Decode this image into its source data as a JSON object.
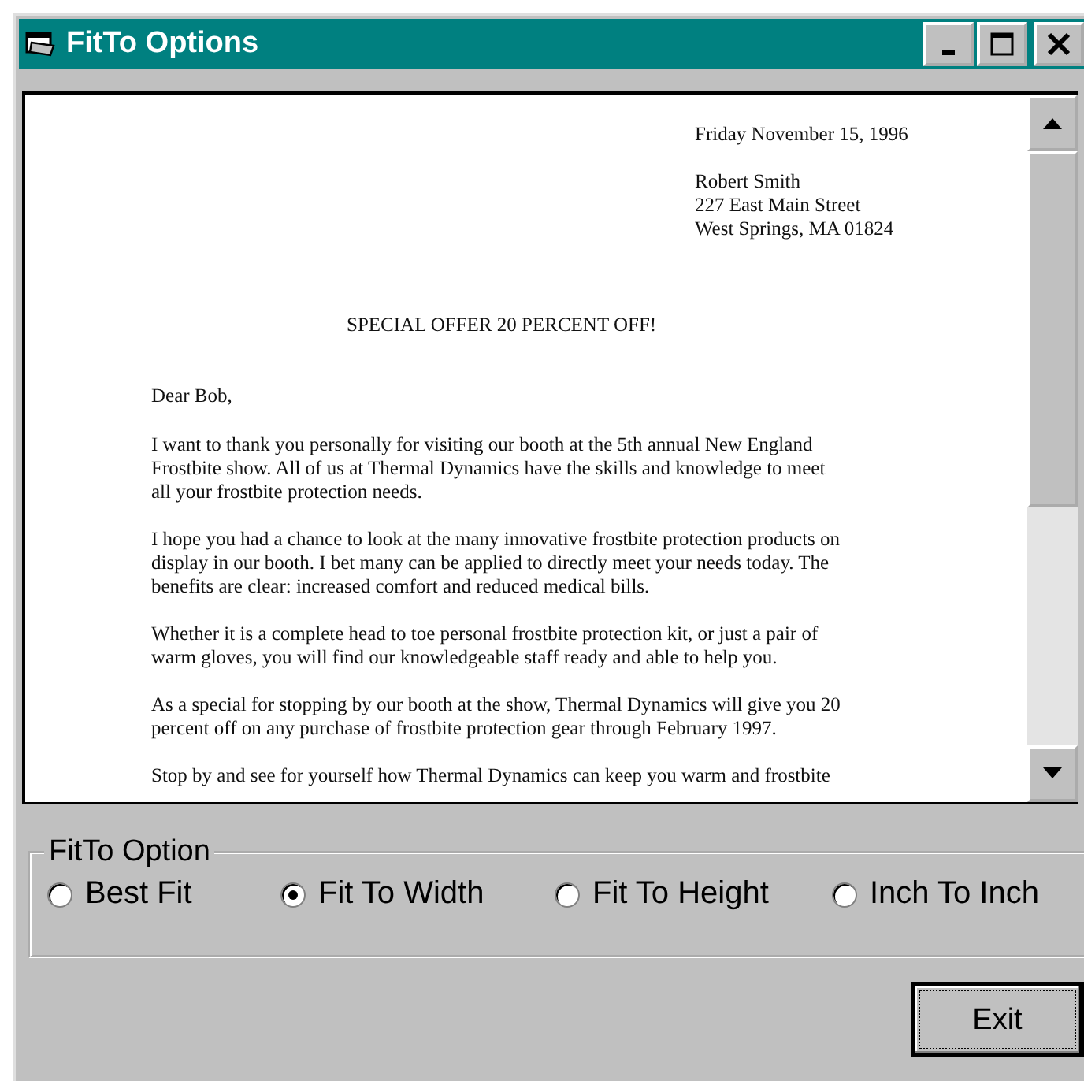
{
  "window": {
    "title": "FitTo Options"
  },
  "document": {
    "date": "Friday November 15, 1996",
    "address": [
      "Robert Smith",
      "227 East Main Street",
      "West Springs, MA 01824"
    ],
    "heading": "SPECIAL OFFER 20 PERCENT OFF!",
    "salutation": "Dear Bob,",
    "paragraphs": [
      "I want to thank you personally for visiting our booth at the 5th annual New England\nFrostbite show.  All of us at Thermal Dynamics have the skills and knowledge to meet\nall your frostbite protection needs.",
      "I hope you had a chance to look at the many innovative frostbite protection products on\ndisplay in our booth. I bet many can be applied to directly meet your needs today.  The\nbenefits are clear: increased comfort and reduced medical bills.",
      "Whether it is a complete head to toe personal frostbite protection kit, or just a pair of\nwarm gloves, you will find our knowledgeable staff ready and able to help you.",
      "As a special for stopping by our booth at the show, Thermal Dynamics will give you  20\npercent off on any purchase of frostbite protection gear through February 1997.",
      "Stop by and see for yourself how Thermal Dynamics can keep you warm and frostbite"
    ]
  },
  "fitto_option": {
    "label": "FitTo Option",
    "options": [
      {
        "label": "Best Fit",
        "selected": false
      },
      {
        "label": "Fit To Width",
        "selected": true
      },
      {
        "label": "Fit To Height",
        "selected": false
      },
      {
        "label": "Inch To Inch",
        "selected": false
      }
    ]
  },
  "buttons": [
    {
      "label": "Exit",
      "focused": true
    }
  ]
}
